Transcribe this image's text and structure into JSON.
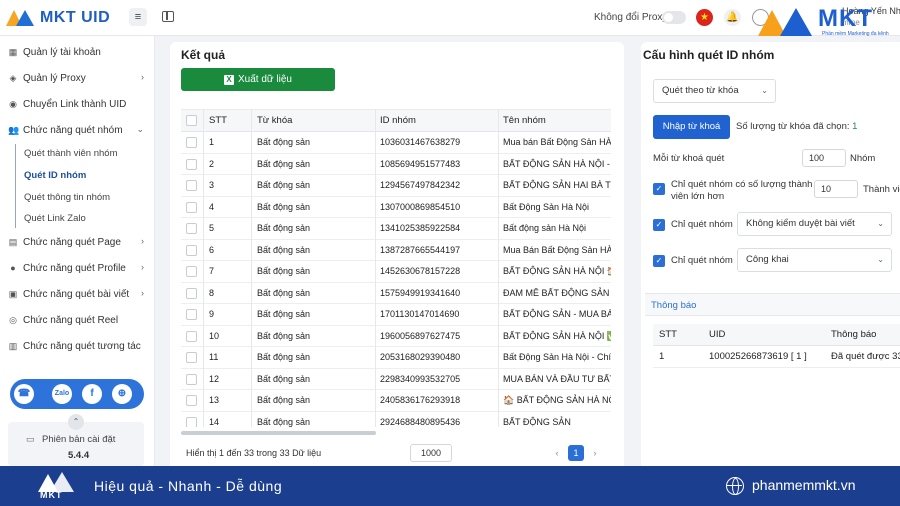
{
  "header": {
    "brand": "MKT UID",
    "proxy_label": "Không đổi Proxy",
    "user_name": "Hoàng Yến Nh",
    "user_sub": "mme"
  },
  "watermark": {
    "text": "MKT",
    "sub": "Phần mềm Marketing đa kênh"
  },
  "sidebar": {
    "items": [
      {
        "label": "Quản lý tài khoản",
        "icon": "grid-icon",
        "chevron": ""
      },
      {
        "label": "Quản lý Proxy",
        "icon": "layers-icon",
        "chevron": "›"
      },
      {
        "label": "Chuyển Link thành UID",
        "icon": "link-circle-icon",
        "chevron": ""
      },
      {
        "label": "Chức năng quét nhóm",
        "icon": "users-icon",
        "chevron": "⌄"
      },
      {
        "label": "Chức năng quét Page",
        "icon": "page-icon",
        "chevron": "›"
      },
      {
        "label": "Chức năng quét Profile",
        "icon": "profile-icon",
        "chevron": "›"
      },
      {
        "label": "Chức năng quét bài viết",
        "icon": "post-icon",
        "chevron": "›"
      },
      {
        "label": "Chức năng quét Reel",
        "icon": "reel-icon",
        "chevron": ""
      },
      {
        "label": "Chức năng quét tương tác",
        "icon": "interaction-icon",
        "chevron": ""
      }
    ],
    "sub_items": [
      {
        "label": "Quét thành viên nhóm",
        "active": false
      },
      {
        "label": "Quét ID nhóm",
        "active": true
      },
      {
        "label": "Quét thông tin nhóm",
        "active": false
      },
      {
        "label": "Quét Link Zalo",
        "active": false
      }
    ],
    "version_label": "Phiên bản cài đặt",
    "version": "5.4.4"
  },
  "results": {
    "title": "Kết quả",
    "export_label": "Xuất dữ liệu",
    "columns": [
      "STT",
      "Từ khóa",
      "ID nhóm",
      "Tên nhóm"
    ],
    "rows": [
      [
        "1",
        "Bất động sản",
        "1036031467638279",
        "Mua bán Bất Động Sản HÀ"
      ],
      [
        "2",
        "Bất động sản",
        "1085694951577483",
        "BẤT ĐỘNG SẢN HÀ NỘI -"
      ],
      [
        "3",
        "Bất động sản",
        "1294567497842342",
        "BẤT ĐỘNG SẢN HAI BÀ TR"
      ],
      [
        "4",
        "Bất động sản",
        "1307000869854510",
        "Bất Động Sản Hà Nội"
      ],
      [
        "5",
        "Bất động sản",
        "1341025385922584",
        "Bất động sản Hà Nội"
      ],
      [
        "6",
        "Bất động sản",
        "1387287665544197",
        "Mua Bán Bất Động Sản HÀ"
      ],
      [
        "7",
        "Bất động sản",
        "1452630678157228",
        "BẤT ĐỘNG SẢN HÀ NỘI 🏠"
      ],
      [
        "8",
        "Bất động sản",
        "1575949919341640",
        "ĐAM MÊ BẤT ĐỘNG SẢN"
      ],
      [
        "9",
        "Bất động sản",
        "1701130147014690",
        "BẤT ĐỘNG SẢN - MUA BÁ"
      ],
      [
        "10",
        "Bất động sản",
        "1960056897627475",
        "BẤT ĐỘNG SẢN HÀ NỘI ✅"
      ],
      [
        "11",
        "Bất động sản",
        "2053168029390480",
        "Bất Động Sản Hà Nội - Chí"
      ],
      [
        "12",
        "Bất động sản",
        "2298340993532705",
        "MUA BÁN VÀ ĐẦU TƯ BẤT"
      ],
      [
        "13",
        "Bất động sản",
        "2405836176293918",
        "🏠 BẤT ĐỘNG SẢN HÀ NỘ"
      ],
      [
        "14",
        "Bất động sản",
        "2924688480895436",
        "BẤT ĐỘNG SẢN"
      ]
    ],
    "summary": "Hiển thị 1 đến 33 trong 33 Dữ liệu",
    "page_size": "1000",
    "prev": "‹",
    "current_page": "1",
    "next": "›"
  },
  "config": {
    "title": "Cấu hình quét ID nhóm",
    "scan_mode": "Quét theo từ khóa",
    "import_label": "Nhập từ khoá",
    "kw_count_label": "Số lượng từ khóa đã chọn:",
    "kw_count": "1",
    "per_kw_label": "Mỗi từ khoá quét",
    "per_kw_value": "100",
    "per_kw_unit": "Nhóm",
    "min_members_label_1": "Chỉ quét nhóm có số lượng thành",
    "min_members_label_2": "viên lớn hơn",
    "min_members_value": "10",
    "min_members_unit": "Thành viê",
    "only_scan_label": "Chỉ quét nhóm",
    "moderation_option": "Không kiểm duyệt bài viết",
    "privacy_option": "Công khai"
  },
  "notice": {
    "title": "Thông báo",
    "columns": [
      "STT",
      "UID",
      "Thông báo"
    ],
    "rows": [
      [
        "1",
        "100025266873619 [ 1 ]",
        "Đã quét được 33/"
      ]
    ]
  },
  "footer": {
    "logo": "MKT",
    "slogan": "Hiệu quả - Nhanh - Dễ dùng",
    "site": "phanmemmkt.vn"
  },
  "colors": {
    "primary": "#2062cf",
    "export_green": "#1a8a3c",
    "footer_bg": "#1b3e8f"
  }
}
